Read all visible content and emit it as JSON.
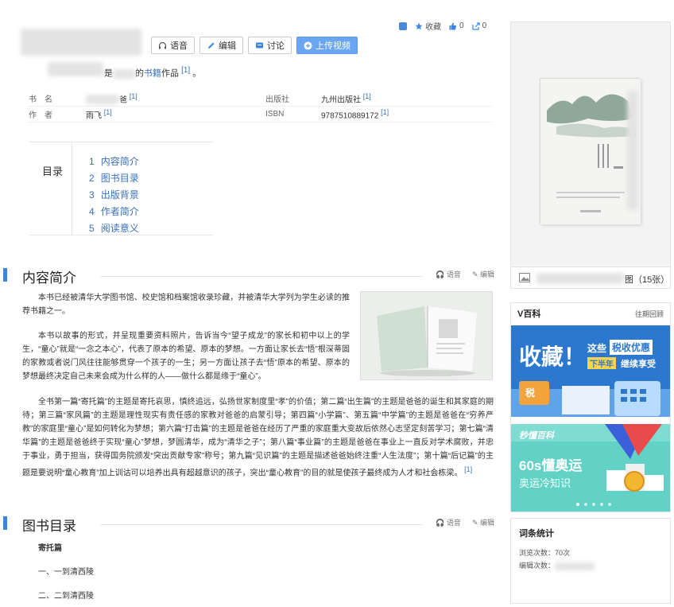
{
  "toolbar": {
    "voice": "语音",
    "edit": "编辑",
    "discuss": "讨论",
    "upload_video": "上传视频"
  },
  "actions": {
    "favorite": "收藏",
    "like_count": "0",
    "share_count": "0"
  },
  "intro": {
    "text_pre": "是",
    "text_mid": "的",
    "link": "书籍",
    "text_post": "作品",
    "ref": "[1]",
    "end": "。"
  },
  "basic_info": {
    "row1": {
      "label": "书　名",
      "value_suffix": "爸",
      "ref": "[1]",
      "label2": "出版社",
      "value2": "九州出版社",
      "ref2": "[1]"
    },
    "row2": {
      "label": "作　者",
      "value": "雨飞",
      "ref": "[1]",
      "label2": "ISBN",
      "value2": "9787510889172",
      "ref2": "[1]"
    }
  },
  "toc": {
    "label": "目录",
    "items": [
      {
        "num": "1",
        "text": "内容简介"
      },
      {
        "num": "2",
        "text": "图书目录"
      },
      {
        "num": "3",
        "text": "出版背景"
      },
      {
        "num": "4",
        "text": "作者简介"
      },
      {
        "num": "5",
        "text": "阅读意义"
      }
    ]
  },
  "section1": {
    "title": "内容简介",
    "voice": "语音",
    "edit": "编辑",
    "p1": "本书已经被清华大学图书馆、校史馆和档案馆收录珍藏，并被清华大学列为学生必读的推荐书籍之一。",
    "p2": "本书以故事的形式，并呈现重要资料照片，告诉当今“望子成龙”的家长和初中以上的学生，“童心”就是“一念之本心”，代表了原本的希望、原本的梦想。一方面让家长去“悟”根深蒂固的家教或者说门风往往能够贯穿一个孩子的一生；另一方面让孩子去“悟”原本的希望、原本的梦想最终决定自己未来会成为什么样的人——做什么都是缘于“童心”。",
    "p3": "全书第一篇“寄托篇”的主题是寄托哀思，慎终追远，弘扬世家制度里“孝”的价值；第二篇“出生篇”的主题是爸爸的诞生和其家庭的期待；第三篇“家风篇”的主题是理性现实有责任感的家教对爸爸的启蒙引导；第四篇“小学篇”、第五篇“中学篇”的主题是爸爸在“穷养严教”的家庭里“童心”是如何转化为梦想；第六篇“打击篇”的主题是爸爸在经历了严重的家庭重大变故后依然心志坚定刻苦学习；第七篇“清华篇”的主题是爸爸终于实现“童心”梦想，梦圆清华，成为“清华之子”；第八篇“事业篇”的主题是爸爸在事业上一直反对学术腐败，并忠于事业，勇于担当，获得国务院颁发“突出贡献专家”称号；第九篇“见识篇”的主题是描述爸爸始终注重“人生法度”；第十篇“后记篇”的主题是要说明“童心教育”加上训诂可以培养出具有超越意识的孩子，突出“童心教育”的目的就是使孩子最终成为人才和社会栋梁。",
    "p3_ref": "[1]"
  },
  "section2": {
    "title": "图书目录",
    "voice": "语音",
    "edit": "编辑",
    "lines": [
      "寄托篇",
      "一、一到清西陵",
      "二、二到清西陵"
    ]
  },
  "cover": {
    "footer_suffix": "图（15张）"
  },
  "vbaike": {
    "title": "V百科",
    "more": "往期回顾",
    "banner1_big": "收藏！",
    "banner1_small": "这些",
    "banner1_highlight": "税收优惠",
    "banner1_sub1": "下半年",
    "banner1_sub2": "继续享受",
    "banner1_tag": "税",
    "banner2_brand": "秒懂百科",
    "banner2_big": "60s懂奥运",
    "banner2_sub": "奥运冷知识"
  },
  "stats": {
    "title": "词条统计",
    "views": "浏览次数：70次",
    "edits_label": "编辑次数："
  },
  "colors": {
    "accent": "#3b87e0",
    "link": "#3a70b8",
    "primary_btn": "#6aa6f2"
  }
}
